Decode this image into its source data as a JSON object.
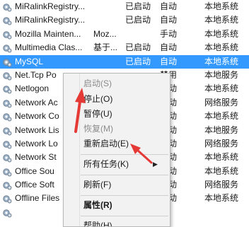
{
  "services": [
    {
      "name": "MiRalinkRegistry...",
      "desc": "",
      "status": "已启动",
      "startup": "自动",
      "logon": "本地系统"
    },
    {
      "name": "MiRalinkRegistry...",
      "desc": "",
      "status": "已启动",
      "startup": "自动",
      "logon": "本地系统"
    },
    {
      "name": "Mozilla Mainten...",
      "desc": "Moz...",
      "status": "",
      "startup": "手动",
      "logon": "本地系统"
    },
    {
      "name": "Multimedia Clas...",
      "desc": "基于...",
      "status": "已启动",
      "startup": "自动",
      "logon": "本地系统"
    },
    {
      "name": "MySQL",
      "desc": "",
      "status": "已启动",
      "startup": "自动",
      "logon": "本地系统"
    },
    {
      "name": "Net.Tcp Po",
      "desc": "",
      "status": "",
      "startup": "禁用",
      "logon": "本地服务"
    },
    {
      "name": "Netlogon",
      "desc": "",
      "status": "",
      "startup": "手动",
      "logon": "本地系统"
    },
    {
      "name": "Network Ac",
      "desc": "",
      "status": "",
      "startup": "手动",
      "logon": "网络服务"
    },
    {
      "name": "Network Co",
      "desc": "",
      "status": "",
      "startup": "手动",
      "logon": "本地系统"
    },
    {
      "name": "Network Lis",
      "desc": "",
      "status": "",
      "startup": "手动",
      "logon": "本地服务"
    },
    {
      "name": "Network Lo",
      "desc": "",
      "status": "",
      "startup": "自动",
      "logon": "网络服务"
    },
    {
      "name": "Network St",
      "desc": "",
      "status": "",
      "startup": "自动",
      "logon": "本地系统"
    },
    {
      "name": "Office Sou",
      "desc": "",
      "status": "",
      "startup": "手动",
      "logon": "本地系统"
    },
    {
      "name": "Office Soft",
      "desc": "",
      "status": "",
      "startup": "手动",
      "logon": "网络服务"
    },
    {
      "name": "Offline Files",
      "desc": "",
      "status": "",
      "startup": "手动",
      "logon": "本地系统"
    },
    {
      "name": "",
      "desc": "",
      "status": "",
      "startup": "",
      "logon": ""
    }
  ],
  "selected_index": 4,
  "context_menu": {
    "start": "启动(S)",
    "stop": "停止(O)",
    "pause": "暂停(U)",
    "resume": "恢复(M)",
    "restart": "重新启动(E)",
    "all_tasks": "所有任务(K)",
    "refresh": "刷新(F)",
    "properties": "属性(R)",
    "help": "帮助(H)"
  },
  "colors": {
    "selection": "#3399ff",
    "annotation_arrow": "#e53935"
  },
  "icons": {
    "service": "gear-icon",
    "submenu": "submenu-arrow-icon"
  }
}
